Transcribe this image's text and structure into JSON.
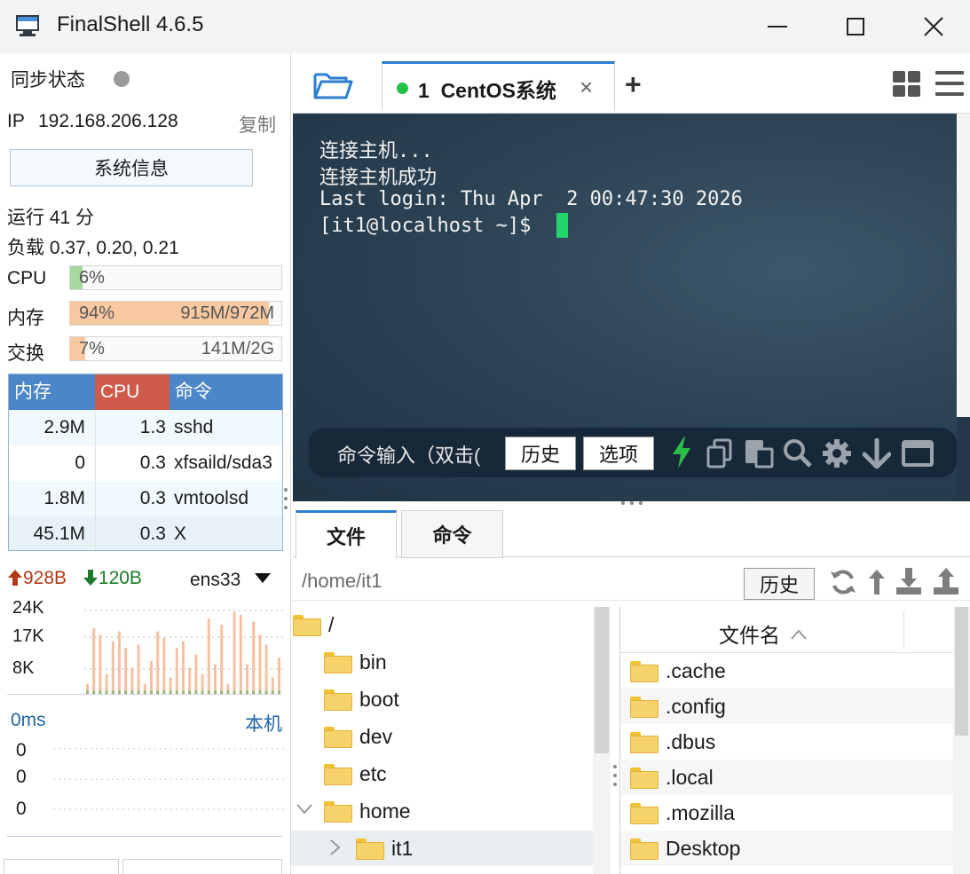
{
  "window": {
    "title": "FinalShell 4.6.5"
  },
  "left": {
    "sync_label": "同步状态",
    "ip_label": "IP",
    "ip_value": "192.168.206.128",
    "copy_label": "复制",
    "sysinfo_button": "系统信息",
    "uptime": "运行 41 分",
    "load": "负载 0.37, 0.20, 0.21",
    "cpu": {
      "label": "CPU",
      "percent_text": "6%",
      "fraction": 0.06
    },
    "mem": {
      "label": "内存",
      "percent_text": "94%",
      "detail": "915M/972M",
      "fraction": 0.94
    },
    "swap": {
      "label": "交换",
      "percent_text": "7%",
      "detail": "141M/2G",
      "fraction": 0.07
    },
    "proc_headers": [
      "内存",
      "CPU",
      "命令"
    ],
    "procs": [
      {
        "mem": "2.9M",
        "cpu": "1.3",
        "cmd": "sshd"
      },
      {
        "mem": "0",
        "cpu": "0.3",
        "cmd": "xfsaild/sda3"
      },
      {
        "mem": "1.8M",
        "cpu": "0.3",
        "cmd": "vmtoolsd"
      },
      {
        "mem": "45.1M",
        "cpu": "0.3",
        "cmd": "X"
      }
    ],
    "net": {
      "up": "928B",
      "down": "120B",
      "iface": "ens33",
      "yticks": [
        "24K",
        "17K",
        "8K"
      ]
    },
    "ping": {
      "latency": "0ms",
      "target": "本机",
      "values": [
        "0",
        "0",
        "0"
      ]
    }
  },
  "tabs": {
    "session_label": "1  CentOS系统",
    "close": "×",
    "add": "+"
  },
  "terminal": {
    "lines": [
      "连接主机...",
      "连接主机成功",
      "Last login: Thu Apr  2 00:47:30 2026",
      "[it1@localhost ~]$ "
    ]
  },
  "cmdbar": {
    "input_placeholder": "命令输入（双击(",
    "history": "历史",
    "options": "选项"
  },
  "bottom": {
    "tab_files": "文件",
    "tab_commands": "命令",
    "path": "/home/it1",
    "history_button": "历史",
    "tree": [
      "/",
      "bin",
      "boot",
      "dev",
      "etc",
      "home",
      "it1"
    ],
    "file_header": "文件名",
    "file_header_sort": "^",
    "files": [
      ".cache",
      ".config",
      ".dbus",
      ".local",
      ".mozilla",
      "Desktop"
    ]
  },
  "colors": {
    "accent": "#2b7fd3",
    "cpu_bar": "#a6d9a0",
    "mem_bar": "#f8c9a0",
    "proc_header_blue": "#4a86c8",
    "proc_header_red": "#cf5a4a",
    "up_arrow": "#b23a17",
    "down_arrow": "#1d7a2a"
  },
  "chart_data": {
    "type": "bar",
    "title": "",
    "yticks": [
      "24K",
      "17K",
      "8K"
    ],
    "series": [
      {
        "values": [
          3,
          20,
          18,
          6,
          16,
          19,
          14,
          8,
          15,
          3,
          10,
          19,
          17,
          5,
          14,
          16,
          8,
          12,
          6,
          23,
          9,
          21,
          3,
          25,
          24,
          9,
          22,
          18,
          15,
          5,
          11
        ]
      },
      {
        "values": [
          1,
          1,
          1,
          1,
          1,
          1,
          1,
          1,
          1,
          1,
          1,
          1,
          1,
          1,
          1,
          1,
          1,
          1,
          1,
          1,
          1,
          1,
          1,
          1,
          1,
          1,
          1,
          1,
          1,
          1,
          1
        ]
      }
    ]
  }
}
